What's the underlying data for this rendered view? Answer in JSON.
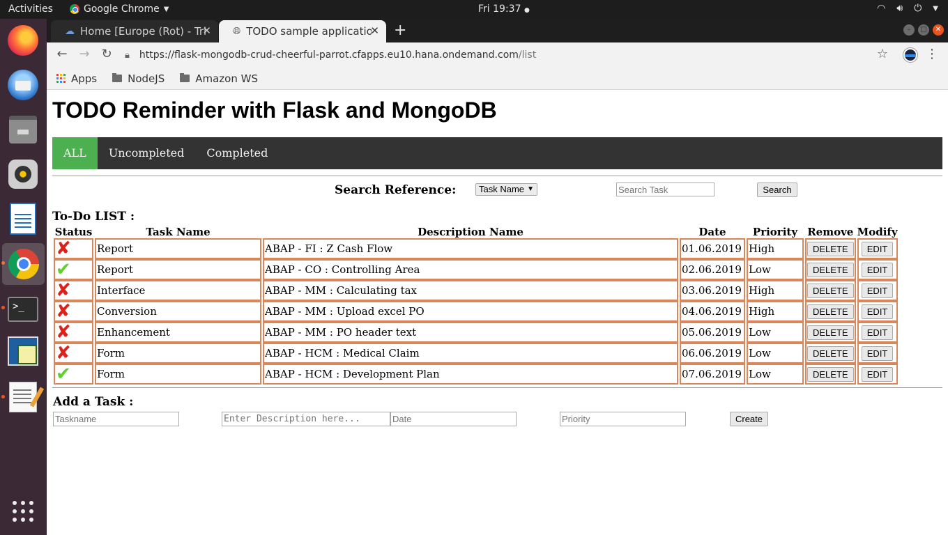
{
  "system": {
    "activities": "Activities",
    "app_name": "Google Chrome",
    "clock": "Fri 19:37"
  },
  "browser": {
    "tabs": [
      {
        "title": "Home [Europe (Rot) - Trial",
        "active": false
      },
      {
        "title": "TODO sample application",
        "active": true
      }
    ],
    "url_main": "https://flask-mongodb-crud-cheerful-parrot.cfapps.eu10.hana.ondemand.com",
    "url_path": "/list",
    "bookmarks": [
      "Apps",
      "NodeJS",
      "Amazon WS"
    ]
  },
  "page": {
    "title": "TODO Reminder with Flask and MongoDB",
    "nav": [
      "ALL",
      "Uncompleted",
      "Completed"
    ],
    "active_nav": "ALL",
    "search": {
      "label": "Search Reference:",
      "select_value": "Task Name",
      "input_placeholder": "Search Task",
      "button": "Search"
    },
    "list_heading": "To-Do LIST :",
    "columns": [
      "Status",
      "Task Name",
      "Description Name",
      "Date",
      "Priority",
      "Remove",
      "Modify"
    ],
    "rows": [
      {
        "status": "uncompleted",
        "task": "Report",
        "description": "ABAP - FI : Z Cash Flow",
        "date": "01.06.2019",
        "priority": "High",
        "remove": "DELETE",
        "modify": "EDIT"
      },
      {
        "status": "completed",
        "task": "Report",
        "description": "ABAP - CO : Controlling Area",
        "date": "02.06.2019",
        "priority": "Low",
        "remove": "DELETE",
        "modify": "EDIT"
      },
      {
        "status": "uncompleted",
        "task": "Interface",
        "description": "ABAP - MM : Calculating tax",
        "date": "03.06.2019",
        "priority": "High",
        "remove": "DELETE",
        "modify": "EDIT"
      },
      {
        "status": "uncompleted",
        "task": "Conversion",
        "description": "ABAP - MM : Upload excel PO",
        "date": "04.06.2019",
        "priority": "High",
        "remove": "DELETE",
        "modify": "EDIT"
      },
      {
        "status": "uncompleted",
        "task": "Enhancement",
        "description": "ABAP - MM : PO header text",
        "date": "05.06.2019",
        "priority": "Low",
        "remove": "DELETE",
        "modify": "EDIT"
      },
      {
        "status": "uncompleted",
        "task": "Form",
        "description": "ABAP - HCM : Medical Claim",
        "date": "06.06.2019",
        "priority": "Low",
        "remove": "DELETE",
        "modify": "EDIT"
      },
      {
        "status": "completed",
        "task": "Form",
        "description": "ABAP - HCM : Development Plan",
        "date": "07.06.2019",
        "priority": "Low",
        "remove": "DELETE",
        "modify": "EDIT"
      }
    ],
    "add_task": {
      "heading": "Add a Task :",
      "taskname_placeholder": "Taskname",
      "description_placeholder": "Enter Description here...",
      "date_placeholder": "Date",
      "priority_placeholder": "Priority",
      "button": "Create"
    }
  },
  "colors": {
    "nav_bg": "#333333",
    "nav_active": "#4caf50",
    "table_border": "#d9875a",
    "status_uncompleted": "#e0211a",
    "status_completed": "#61d02c"
  },
  "icons": {
    "status_uncompleted": "red-cross-icon",
    "status_completed": "green-check-icon"
  }
}
